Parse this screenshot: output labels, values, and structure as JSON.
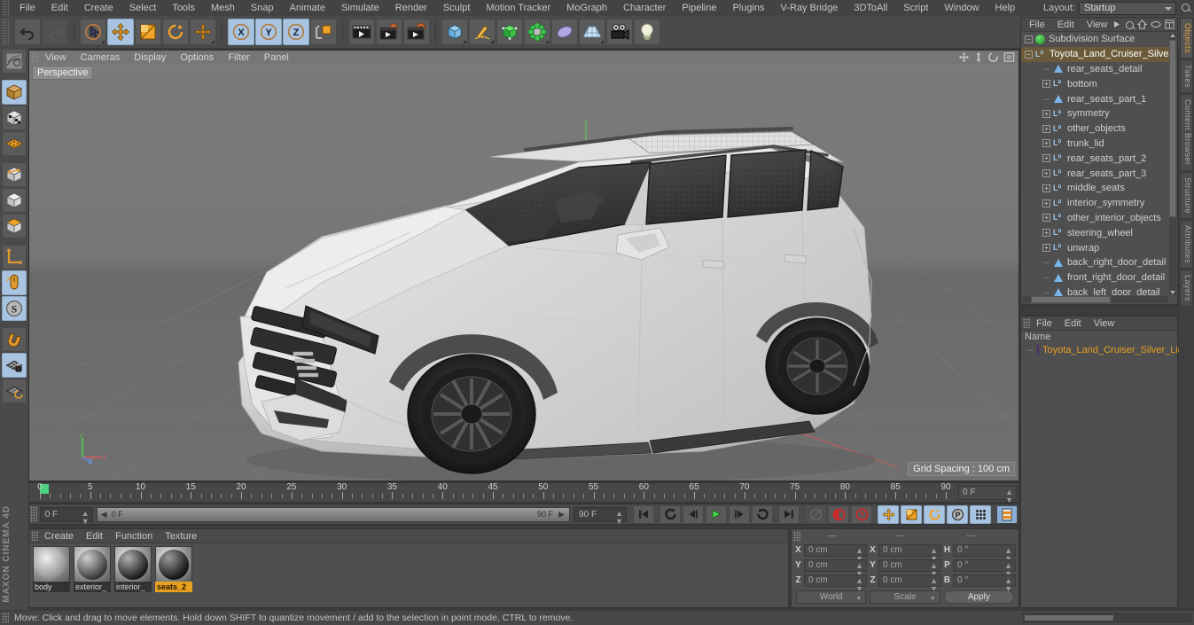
{
  "app": {
    "brand": "MAXON CINEMA 4D"
  },
  "menubar": {
    "items": [
      "File",
      "Edit",
      "Create",
      "Select",
      "Tools",
      "Mesh",
      "Snap",
      "Animate",
      "Simulate",
      "Render",
      "Sculpt",
      "Motion Tracker",
      "MoGraph",
      "Character",
      "Pipeline",
      "Plugins",
      "V-Ray Bridge",
      "3DToAll",
      "Script",
      "Window",
      "Help"
    ],
    "layout_label": "Layout:",
    "layout_value": "Startup"
  },
  "toolbar": {
    "undo": "undo-icon",
    "redo": "redo-icon",
    "select": "live-selection-icon",
    "move": "move-icon",
    "scale": "scale-icon",
    "rotate": "rotate-icon",
    "translate": "translate-icon",
    "axis_x": "X",
    "axis_y": "Y",
    "axis_z": "Z",
    "world": "world-coordinate-icon",
    "render_view": "render-view-icon",
    "render_picture": "render-to-picture-viewer-icon",
    "render_settings": "render-settings-icon",
    "cube": "cube-primitive-icon",
    "spline": "pen-spline-icon",
    "array": "array-generator-icon",
    "subdivision": "subdivision-surface-icon",
    "bend": "bend-deformer-icon",
    "floor": "floor-environment-icon",
    "camera": "camera-icon",
    "light": "light-icon"
  },
  "left_toolbar": {
    "items": [
      {
        "name": "selection-tools-icon",
        "active": false
      },
      {
        "name": "model-mode-icon",
        "active": true
      },
      {
        "name": "texture-mode-icon",
        "active": false
      },
      {
        "name": "points-mode-icon",
        "active": false
      },
      {
        "name": "edges-mode-icon",
        "active": false
      },
      {
        "name": "polygons-mode-icon",
        "active": false
      },
      {
        "name": "object-axis-mode-icon",
        "active": false
      },
      {
        "name": "world-object-axis-icon",
        "active": false
      },
      {
        "name": "viewport-solo-icon",
        "active": true
      },
      {
        "name": "enable-snap-icon",
        "active": true
      },
      {
        "name": "magnet-tool-icon",
        "active": false
      },
      {
        "name": "workplane-lock-icon",
        "active": true
      },
      {
        "name": "workplane-reset-icon",
        "active": false
      }
    ]
  },
  "viewport": {
    "menu": [
      "View",
      "Cameras",
      "Display",
      "Options",
      "Filter",
      "Panel"
    ],
    "label": "Perspective",
    "grid_spacing": "Grid Spacing : 100 cm",
    "axis": {
      "y": "Y",
      "x": "X",
      "z": "Z"
    },
    "corner_icons": [
      "move-view-icon",
      "scale-view-icon",
      "rotate-view-icon",
      "maximize-view-icon"
    ]
  },
  "object_manager": {
    "menu": [
      "File",
      "Edit",
      "View"
    ],
    "header_icons": [
      "play-arrow-icon",
      "search-icon",
      "home-icon",
      "ellipse-icon",
      "expand-icon"
    ],
    "items": [
      {
        "label": "Subdivision Surface",
        "depth": 0,
        "icon": "subdivision-surface-icon",
        "expander": "minus",
        "selected": false
      },
      {
        "label": "Toyota_Land_Cruiser_Silver_Li",
        "depth": 1,
        "icon": "null-object-icon",
        "expander": "minus",
        "selected": true
      },
      {
        "label": "rear_seats_detail",
        "depth": 2,
        "icon": "polygon-object-icon",
        "expander": "none",
        "selected": false
      },
      {
        "label": "bottom",
        "depth": 2,
        "icon": "null-object-icon",
        "expander": "plus",
        "selected": false
      },
      {
        "label": "rear_seats_part_1",
        "depth": 2,
        "icon": "polygon-object-icon",
        "expander": "none",
        "selected": false
      },
      {
        "label": "symmetry",
        "depth": 2,
        "icon": "null-object-icon",
        "expander": "plus",
        "selected": false
      },
      {
        "label": "other_objects",
        "depth": 2,
        "icon": "null-object-icon",
        "expander": "plus",
        "selected": false
      },
      {
        "label": "trunk_lid",
        "depth": 2,
        "icon": "null-object-icon",
        "expander": "plus",
        "selected": false
      },
      {
        "label": "rear_seats_part_2",
        "depth": 2,
        "icon": "null-object-icon",
        "expander": "plus",
        "selected": false
      },
      {
        "label": "rear_seats_part_3",
        "depth": 2,
        "icon": "null-object-icon",
        "expander": "plus",
        "selected": false
      },
      {
        "label": "middle_seats",
        "depth": 2,
        "icon": "null-object-icon",
        "expander": "plus",
        "selected": false
      },
      {
        "label": "interior_symmetry",
        "depth": 2,
        "icon": "null-object-icon",
        "expander": "plus",
        "selected": false
      },
      {
        "label": "other_interior_objects",
        "depth": 2,
        "icon": "null-object-icon",
        "expander": "plus",
        "selected": false
      },
      {
        "label": "steering_wheel",
        "depth": 2,
        "icon": "null-object-icon",
        "expander": "plus",
        "selected": false
      },
      {
        "label": "unwrap",
        "depth": 2,
        "icon": "null-object-icon",
        "expander": "plus",
        "selected": false
      },
      {
        "label": "back_right_door_detail",
        "depth": 2,
        "icon": "polygon-object-icon",
        "expander": "none",
        "selected": false
      },
      {
        "label": "front_right_door_detail",
        "depth": 2,
        "icon": "polygon-object-icon",
        "expander": "none",
        "selected": false
      },
      {
        "label": "back_left_door_detail",
        "depth": 2,
        "icon": "polygon-object-icon",
        "expander": "none",
        "selected": false
      }
    ]
  },
  "layer_manager": {
    "menu": [
      "File",
      "Edit",
      "View"
    ],
    "column_header": "Name",
    "rows": [
      {
        "label": "Toyota_Land_Cruiser_Silver_Light_",
        "color": "#7a52a0",
        "selected": true
      }
    ]
  },
  "vertical_tabs": [
    {
      "label": "Objects",
      "active": true
    },
    {
      "label": "Takes",
      "active": false
    },
    {
      "label": "Content Browser",
      "active": false
    },
    {
      "label": "Structure",
      "active": false
    },
    {
      "label": "Attributes",
      "active": false
    },
    {
      "label": "Layers",
      "active": false
    }
  ],
  "timeline": {
    "ticks": [
      0,
      5,
      10,
      15,
      20,
      25,
      30,
      35,
      40,
      45,
      50,
      55,
      60,
      65,
      70,
      75,
      80,
      85,
      90
    ],
    "range_start": 0,
    "range_end": 90,
    "current_frame_field": "0 F"
  },
  "playback": {
    "current_frame": "0 F",
    "start_field": "0 F",
    "end_label": "90 F",
    "end_field": "90 F",
    "buttons": [
      {
        "name": "go-to-start-button",
        "glyph": "⏮"
      },
      {
        "name": "play-backwards-button",
        "glyph": "↺"
      },
      {
        "name": "previous-frame-button",
        "glyph": "◀"
      },
      {
        "name": "play-forward-button",
        "glyph": "▶"
      },
      {
        "name": "next-frame-button",
        "glyph": "▶"
      },
      {
        "name": "play-loop-button",
        "glyph": "↻"
      },
      {
        "name": "go-to-end-button",
        "glyph": "⏭"
      },
      {
        "name": "record-active-objects-button",
        "glyph": "◎"
      },
      {
        "name": "autokeying-button",
        "glyph": "◐"
      },
      {
        "name": "keyframe-selection-button",
        "glyph": "?"
      },
      {
        "name": "position-key-button",
        "glyph": "+"
      },
      {
        "name": "scale-key-button",
        "glyph": "◧"
      },
      {
        "name": "rotation-key-button",
        "glyph": "↻"
      },
      {
        "name": "parameter-key-button",
        "glyph": "P"
      },
      {
        "name": "point-level-animation-button",
        "glyph": "∷"
      },
      {
        "name": "keyframe-mode-button",
        "glyph": "▤"
      }
    ]
  },
  "material_manager": {
    "menu": [
      "Create",
      "Edit",
      "Function",
      "Texture"
    ],
    "materials": [
      {
        "name": "body",
        "selected": false,
        "color1": "#efefef",
        "color2": "#8f8f8f"
      },
      {
        "name": "exterior_",
        "selected": false,
        "color1": "#cfcfcf",
        "color2": "#3a3a3a"
      },
      {
        "name": "interior_",
        "selected": false,
        "color1": "#b0b0b0",
        "color2": "#1a1a1a"
      },
      {
        "name": "seats_2",
        "selected": true,
        "color1": "#9a9a9a",
        "color2": "#141414"
      }
    ]
  },
  "coordinates": {
    "headers": [
      "—",
      "—",
      "—"
    ],
    "rows": [
      {
        "axis1": "X",
        "val1": "0 cm",
        "axis2": "X",
        "val2": "0 cm",
        "axis3": "H",
        "val3": "0 °"
      },
      {
        "axis1": "Y",
        "val1": "0 cm",
        "axis2": "Y",
        "val2": "0 cm",
        "axis3": "P",
        "val3": "0 °"
      },
      {
        "axis1": "Z",
        "val1": "0 cm",
        "axis2": "Z",
        "val2": "0 cm",
        "axis3": "B",
        "val3": "0 °"
      }
    ],
    "world_select": "World",
    "scale_select": "Scale",
    "apply_button": "Apply"
  },
  "statusbar": {
    "message": "Move: Click and drag to move elements. Hold down SHIFT to quantize movement / add to the selection in point mode, CTRL to remove."
  }
}
